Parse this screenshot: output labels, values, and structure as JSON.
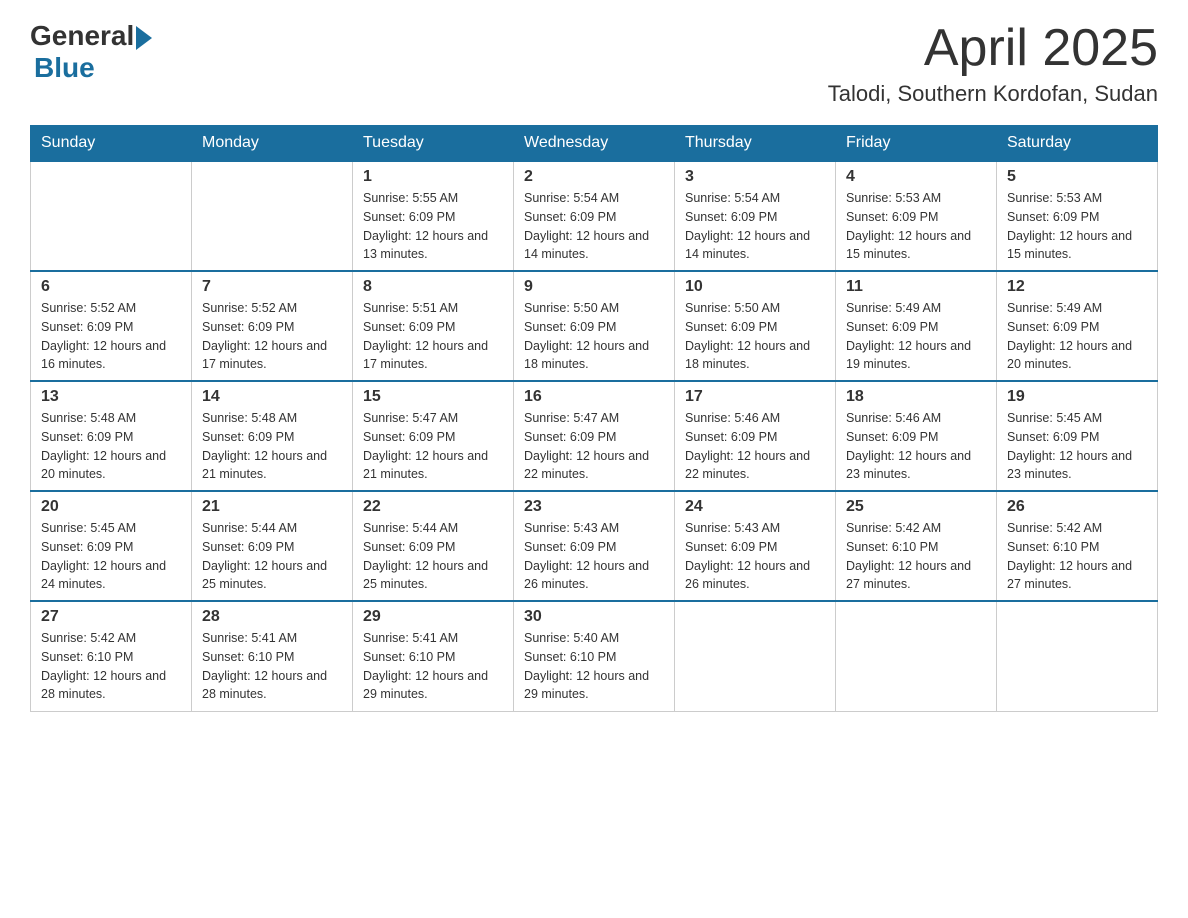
{
  "header": {
    "logo_general": "General",
    "logo_blue": "Blue",
    "title": "April 2025",
    "subtitle": "Talodi, Southern Kordofan, Sudan"
  },
  "days_of_week": [
    "Sunday",
    "Monday",
    "Tuesday",
    "Wednesday",
    "Thursday",
    "Friday",
    "Saturday"
  ],
  "weeks": [
    [
      {
        "day": "",
        "sunrise": "",
        "sunset": "",
        "daylight": ""
      },
      {
        "day": "",
        "sunrise": "",
        "sunset": "",
        "daylight": ""
      },
      {
        "day": "1",
        "sunrise": "Sunrise: 5:55 AM",
        "sunset": "Sunset: 6:09 PM",
        "daylight": "Daylight: 12 hours and 13 minutes."
      },
      {
        "day": "2",
        "sunrise": "Sunrise: 5:54 AM",
        "sunset": "Sunset: 6:09 PM",
        "daylight": "Daylight: 12 hours and 14 minutes."
      },
      {
        "day": "3",
        "sunrise": "Sunrise: 5:54 AM",
        "sunset": "Sunset: 6:09 PM",
        "daylight": "Daylight: 12 hours and 14 minutes."
      },
      {
        "day": "4",
        "sunrise": "Sunrise: 5:53 AM",
        "sunset": "Sunset: 6:09 PM",
        "daylight": "Daylight: 12 hours and 15 minutes."
      },
      {
        "day": "5",
        "sunrise": "Sunrise: 5:53 AM",
        "sunset": "Sunset: 6:09 PM",
        "daylight": "Daylight: 12 hours and 15 minutes."
      }
    ],
    [
      {
        "day": "6",
        "sunrise": "Sunrise: 5:52 AM",
        "sunset": "Sunset: 6:09 PM",
        "daylight": "Daylight: 12 hours and 16 minutes."
      },
      {
        "day": "7",
        "sunrise": "Sunrise: 5:52 AM",
        "sunset": "Sunset: 6:09 PM",
        "daylight": "Daylight: 12 hours and 17 minutes."
      },
      {
        "day": "8",
        "sunrise": "Sunrise: 5:51 AM",
        "sunset": "Sunset: 6:09 PM",
        "daylight": "Daylight: 12 hours and 17 minutes."
      },
      {
        "day": "9",
        "sunrise": "Sunrise: 5:50 AM",
        "sunset": "Sunset: 6:09 PM",
        "daylight": "Daylight: 12 hours and 18 minutes."
      },
      {
        "day": "10",
        "sunrise": "Sunrise: 5:50 AM",
        "sunset": "Sunset: 6:09 PM",
        "daylight": "Daylight: 12 hours and 18 minutes."
      },
      {
        "day": "11",
        "sunrise": "Sunrise: 5:49 AM",
        "sunset": "Sunset: 6:09 PM",
        "daylight": "Daylight: 12 hours and 19 minutes."
      },
      {
        "day": "12",
        "sunrise": "Sunrise: 5:49 AM",
        "sunset": "Sunset: 6:09 PM",
        "daylight": "Daylight: 12 hours and 20 minutes."
      }
    ],
    [
      {
        "day": "13",
        "sunrise": "Sunrise: 5:48 AM",
        "sunset": "Sunset: 6:09 PM",
        "daylight": "Daylight: 12 hours and 20 minutes."
      },
      {
        "day": "14",
        "sunrise": "Sunrise: 5:48 AM",
        "sunset": "Sunset: 6:09 PM",
        "daylight": "Daylight: 12 hours and 21 minutes."
      },
      {
        "day": "15",
        "sunrise": "Sunrise: 5:47 AM",
        "sunset": "Sunset: 6:09 PM",
        "daylight": "Daylight: 12 hours and 21 minutes."
      },
      {
        "day": "16",
        "sunrise": "Sunrise: 5:47 AM",
        "sunset": "Sunset: 6:09 PM",
        "daylight": "Daylight: 12 hours and 22 minutes."
      },
      {
        "day": "17",
        "sunrise": "Sunrise: 5:46 AM",
        "sunset": "Sunset: 6:09 PM",
        "daylight": "Daylight: 12 hours and 22 minutes."
      },
      {
        "day": "18",
        "sunrise": "Sunrise: 5:46 AM",
        "sunset": "Sunset: 6:09 PM",
        "daylight": "Daylight: 12 hours and 23 minutes."
      },
      {
        "day": "19",
        "sunrise": "Sunrise: 5:45 AM",
        "sunset": "Sunset: 6:09 PM",
        "daylight": "Daylight: 12 hours and 23 minutes."
      }
    ],
    [
      {
        "day": "20",
        "sunrise": "Sunrise: 5:45 AM",
        "sunset": "Sunset: 6:09 PM",
        "daylight": "Daylight: 12 hours and 24 minutes."
      },
      {
        "day": "21",
        "sunrise": "Sunrise: 5:44 AM",
        "sunset": "Sunset: 6:09 PM",
        "daylight": "Daylight: 12 hours and 25 minutes."
      },
      {
        "day": "22",
        "sunrise": "Sunrise: 5:44 AM",
        "sunset": "Sunset: 6:09 PM",
        "daylight": "Daylight: 12 hours and 25 minutes."
      },
      {
        "day": "23",
        "sunrise": "Sunrise: 5:43 AM",
        "sunset": "Sunset: 6:09 PM",
        "daylight": "Daylight: 12 hours and 26 minutes."
      },
      {
        "day": "24",
        "sunrise": "Sunrise: 5:43 AM",
        "sunset": "Sunset: 6:09 PM",
        "daylight": "Daylight: 12 hours and 26 minutes."
      },
      {
        "day": "25",
        "sunrise": "Sunrise: 5:42 AM",
        "sunset": "Sunset: 6:10 PM",
        "daylight": "Daylight: 12 hours and 27 minutes."
      },
      {
        "day": "26",
        "sunrise": "Sunrise: 5:42 AM",
        "sunset": "Sunset: 6:10 PM",
        "daylight": "Daylight: 12 hours and 27 minutes."
      }
    ],
    [
      {
        "day": "27",
        "sunrise": "Sunrise: 5:42 AM",
        "sunset": "Sunset: 6:10 PM",
        "daylight": "Daylight: 12 hours and 28 minutes."
      },
      {
        "day": "28",
        "sunrise": "Sunrise: 5:41 AM",
        "sunset": "Sunset: 6:10 PM",
        "daylight": "Daylight: 12 hours and 28 minutes."
      },
      {
        "day": "29",
        "sunrise": "Sunrise: 5:41 AM",
        "sunset": "Sunset: 6:10 PM",
        "daylight": "Daylight: 12 hours and 29 minutes."
      },
      {
        "day": "30",
        "sunrise": "Sunrise: 5:40 AM",
        "sunset": "Sunset: 6:10 PM",
        "daylight": "Daylight: 12 hours and 29 minutes."
      },
      {
        "day": "",
        "sunrise": "",
        "sunset": "",
        "daylight": ""
      },
      {
        "day": "",
        "sunrise": "",
        "sunset": "",
        "daylight": ""
      },
      {
        "day": "",
        "sunrise": "",
        "sunset": "",
        "daylight": ""
      }
    ]
  ]
}
